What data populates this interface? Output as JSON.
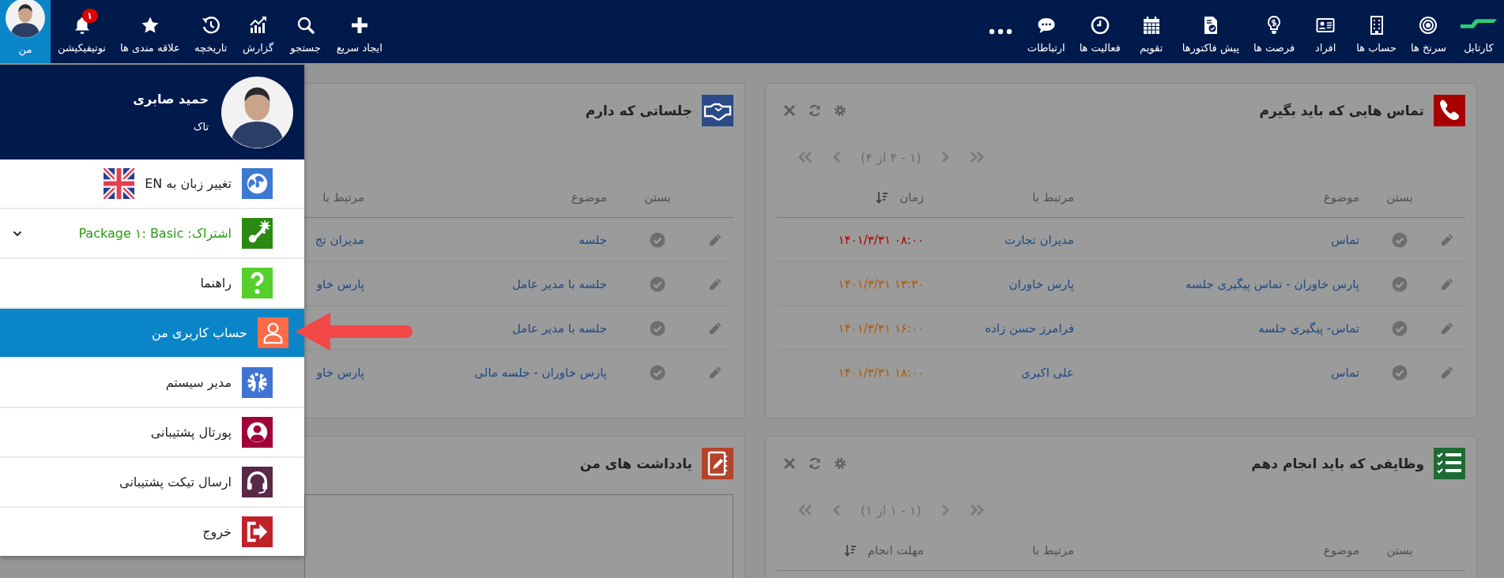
{
  "top_nav": {
    "items": [
      {
        "label": "کارتابل"
      },
      {
        "label": "سرنخ ها"
      },
      {
        "label": "حساب ها"
      },
      {
        "label": "افراد"
      },
      {
        "label": "فرصت ها"
      },
      {
        "label": "پیش فاکتورها"
      },
      {
        "label": "تقویم"
      },
      {
        "label": "فعالیت ها"
      },
      {
        "label": "ارتباطات"
      }
    ]
  },
  "user_nav": {
    "items": [
      {
        "label": "ایجاد سریع",
        "selected": false
      },
      {
        "label": "جستجو",
        "selected": false
      },
      {
        "label": "گزارش",
        "selected": false
      },
      {
        "label": "تاریخچه",
        "selected": false
      },
      {
        "label": "علاقه مندی ها",
        "selected": false
      },
      {
        "label": "نوتیفیکیشن",
        "selected": false,
        "badge": "۱"
      },
      {
        "label": "من",
        "selected": true
      }
    ]
  },
  "user_menu": {
    "name": "حمید صابری",
    "subtitle": "تاک",
    "items": [
      {
        "kind": "language",
        "label": "تغییر زبان به EN",
        "selected": false
      },
      {
        "kind": "subscription",
        "label": "اشتراک: Package ۱: Basic",
        "selected": false
      },
      {
        "kind": "link",
        "label": "راهنما",
        "selected": false
      },
      {
        "kind": "link",
        "label": "حساب کاربری من",
        "selected": true
      },
      {
        "kind": "link",
        "label": "مدیر سیستم",
        "selected": false
      },
      {
        "kind": "link",
        "label": "پورتال پشتیبانی",
        "selected": false
      },
      {
        "kind": "link",
        "label": "ارسال تیکت پشتیبانی",
        "selected": false
      },
      {
        "kind": "link",
        "label": "خروج",
        "selected": false
      }
    ]
  },
  "dashboard": {
    "columns": [
      {
        "panels": [
          {
            "kind": "calls",
            "title": "تماس هایی که باید بگیرم",
            "show_tools": true,
            "pager": "(۱ - ۴ از ۴)",
            "columns": [
              {
                "label": "بستن"
              },
              {
                "label": "موضوع"
              },
              {
                "label": "مرتبط با"
              },
              {
                "label": "زمان",
                "sorted": true
              }
            ],
            "rows": [
              {
                "subject": "تماس",
                "related": "مدیران تجارت",
                "time": "۱۴۰۱/۳/۳۱ ۰۸:۰۰",
                "color": "#b00000"
              },
              {
                "subject": "پارس خاوران - تماس پیگیری جلسه",
                "related": "پارس خاوران",
                "time": "۱۴۰۱/۳/۳۱ ۱۳:۳۰",
                "color": "#b05a00"
              },
              {
                "subject": "تماس- پیگیری جلسه",
                "related": "فرامرز حسن زاده",
                "time": "۱۴۰۱/۳/۳۱ ۱۶:۰۰",
                "color": "#b05a00"
              },
              {
                "subject": "تماس",
                "related": "علی اکبری",
                "time": "۱۴۰۱/۳/۳۱ ۱۸:۰۰",
                "color": "#b05a00"
              }
            ]
          },
          {
            "kind": "tasks",
            "title": "وظایفی که باید انجام دهم",
            "show_tools": true,
            "pager": "(۱ - ۱ از ۱)",
            "columns": [
              {
                "label": "بستن"
              },
              {
                "label": "موضوع"
              },
              {
                "label": "مرتبط با"
              },
              {
                "label": "مهلت انجام",
                "sorted": true
              }
            ]
          }
        ]
      },
      {
        "panels": [
          {
            "kind": "meetings",
            "title": "جلساتی که دارم",
            "columns": [
              {
                "label": "بستن"
              },
              {
                "label": "موضوع"
              },
              {
                "label": "مرتبط با"
              }
            ],
            "rows": [
              {
                "subject": "جلسه",
                "related": "مدیران تج"
              },
              {
                "subject": "جلسه با مدیر عامل",
                "related": "پارس خاو"
              },
              {
                "subject": "جلسه با مدیر عامل"
              },
              {
                "subject": "پارس خاوران - جلسه مالی",
                "related": "پارس خاو"
              }
            ]
          },
          {
            "kind": "notes",
            "title": "یادداشت های من"
          }
        ]
      }
    ]
  }
}
